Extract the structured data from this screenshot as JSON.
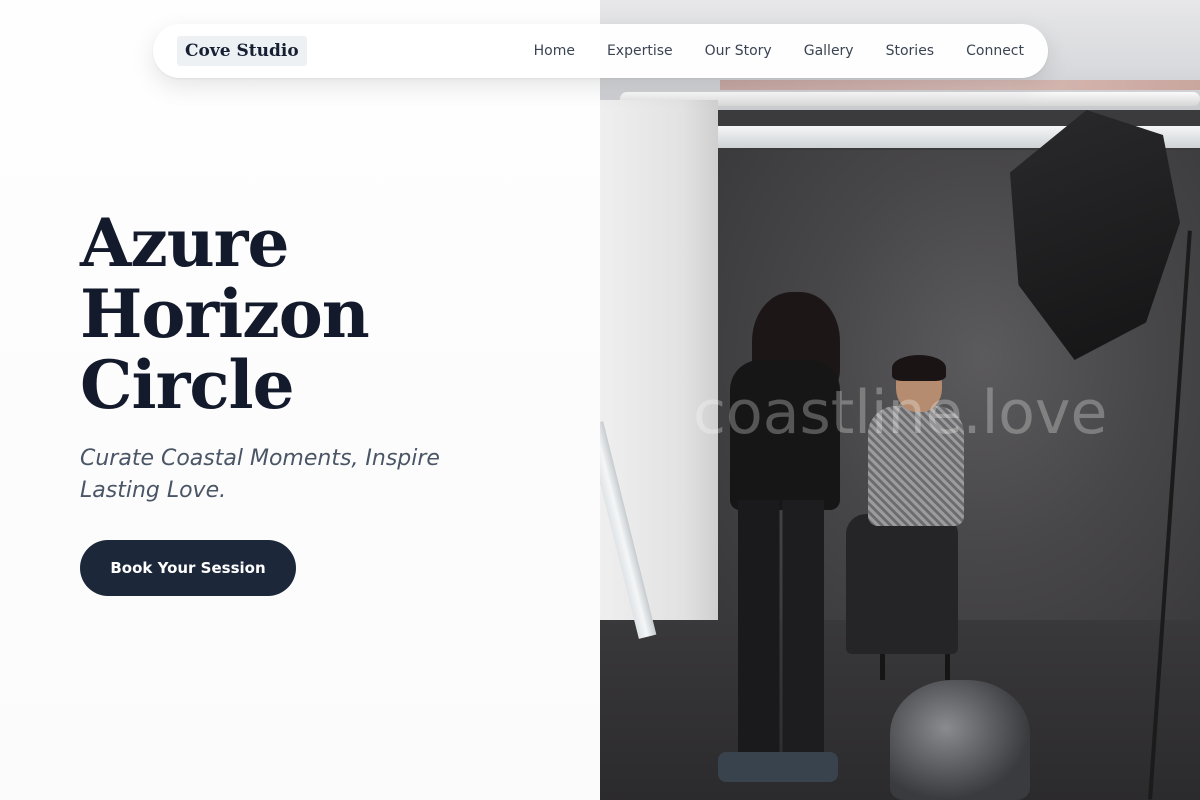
{
  "nav": {
    "logo": "Cove Studio",
    "links": [
      "Home",
      "Expertise",
      "Our Story",
      "Gallery",
      "Stories",
      "Connect"
    ]
  },
  "hero": {
    "title_lines": [
      "Azure",
      "Horizon",
      "Circle"
    ],
    "subtitle": "Curate Coastal Moments, Inspire Lasting Love.",
    "cta_label": "Book Your Session"
  },
  "photo": {
    "watermark": "coastline.love",
    "alt": "Photographer talking with smiling woman seated on stool in studio"
  },
  "colors": {
    "primary": "#1c273a",
    "heading": "#131a2b",
    "subtitle": "#4a5566",
    "nav_text": "#3b4453",
    "background": "#fcfcfc"
  }
}
